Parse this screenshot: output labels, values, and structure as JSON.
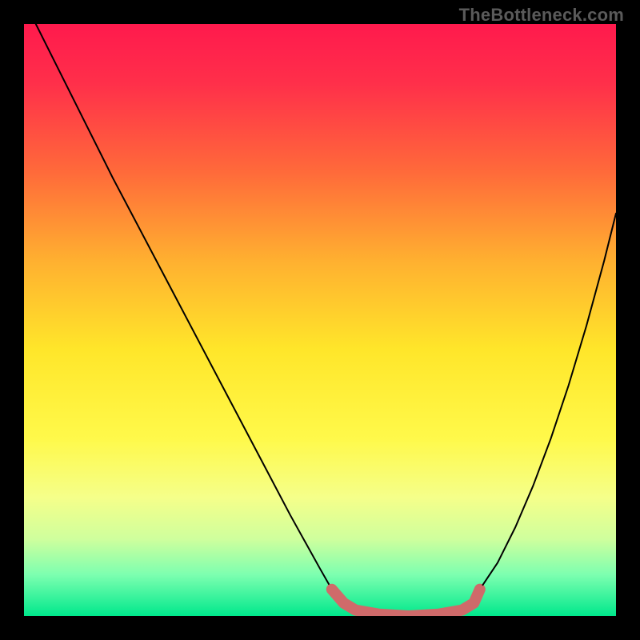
{
  "watermark": "TheBottleneck.com",
  "chart_data": {
    "type": "line",
    "title": "",
    "xlabel": "",
    "ylabel": "",
    "xlim": [
      0,
      100
    ],
    "ylim": [
      0,
      100
    ],
    "background_gradient": {
      "stops": [
        {
          "pos": 0.0,
          "color": "#ff1a4d"
        },
        {
          "pos": 0.1,
          "color": "#ff2f4a"
        },
        {
          "pos": 0.25,
          "color": "#ff6a3a"
        },
        {
          "pos": 0.4,
          "color": "#ffb030"
        },
        {
          "pos": 0.55,
          "color": "#ffe62a"
        },
        {
          "pos": 0.7,
          "color": "#fff94a"
        },
        {
          "pos": 0.8,
          "color": "#f5ff8a"
        },
        {
          "pos": 0.87,
          "color": "#cfff9d"
        },
        {
          "pos": 0.93,
          "color": "#7dffb0"
        },
        {
          "pos": 1.0,
          "color": "#00e88c"
        }
      ]
    },
    "series": [
      {
        "name": "left-branch",
        "color": "#000000",
        "stroke_width": 2,
        "x": [
          2,
          5,
          10,
          15,
          20,
          25,
          30,
          35,
          40,
          45,
          50,
          52
        ],
        "y": [
          100,
          94,
          84,
          74,
          64.5,
          55,
          45.5,
          36,
          26.5,
          17,
          8,
          4.5
        ]
      },
      {
        "name": "valley-band",
        "color": "#cf6a6a",
        "stroke_width": 14,
        "x": [
          52,
          54,
          56,
          60,
          65,
          70,
          74,
          76,
          77
        ],
        "y": [
          4.5,
          2.2,
          1.0,
          0.3,
          0.0,
          0.3,
          1.0,
          2.2,
          4.5
        ]
      },
      {
        "name": "right-branch",
        "color": "#000000",
        "stroke_width": 2,
        "x": [
          77,
          80,
          83,
          86,
          89,
          92,
          95,
          98,
          100
        ],
        "y": [
          4.5,
          9,
          15,
          22,
          30,
          39,
          49,
          60,
          68
        ]
      },
      {
        "name": "valley-end-dot",
        "type": "scatter",
        "color": "#cf6a6a",
        "radius": 6,
        "x": [
          77
        ],
        "y": [
          4.5
        ]
      }
    ]
  }
}
